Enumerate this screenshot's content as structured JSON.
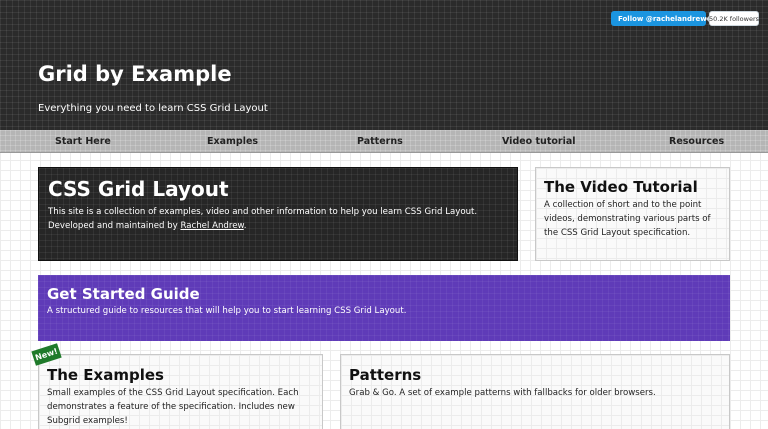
{
  "header": {
    "title": "Grid by Example",
    "tagline": "Everything you need to learn CSS Grid Layout"
  },
  "twitter": {
    "button_label": "Follow @rachelandrew",
    "followers": "50.2K followers",
    "brand_color": "#1b95e0"
  },
  "nav": {
    "items": [
      {
        "label": "Start Here"
      },
      {
        "label": "Examples"
      },
      {
        "label": "Patterns"
      },
      {
        "label": "Video tutorial"
      },
      {
        "label": "Resources"
      }
    ]
  },
  "hero": {
    "title": "CSS Grid Layout",
    "text": "This site is a collection of examples, video and other information to help you learn CSS Grid Layout. Developed and maintained by ",
    "link_text": "Rachel Andrew",
    "text_end": "."
  },
  "video": {
    "title": "The Video Tutorial",
    "text": "A collection of short and to the point videos, demonstrating various parts of the CSS Grid Layout specification."
  },
  "guide": {
    "title": "Get Started Guide",
    "text": "A structured guide to resources that will help you to start learning CSS Grid Layout.",
    "color": "#5f3bb8"
  },
  "examples": {
    "badge": "New!",
    "title": "The Examples",
    "text": "Small examples of the CSS Grid Layout specification. Each demonstrates a feature of the specification. Includes new Subgrid examples!"
  },
  "patterns": {
    "title": "Patterns",
    "text": "Grab & Go. A set of example patterns with fallbacks for older browsers."
  }
}
